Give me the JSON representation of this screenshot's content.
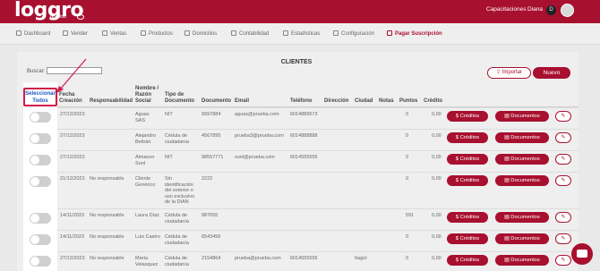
{
  "app": {
    "logo": "loggro",
    "logo_sub": "restobar",
    "org": "Capacitaciones",
    "user": "Diana",
    "user_badge": "D"
  },
  "nav": [
    {
      "label": "Dashboard",
      "icon": "dashboard-icon"
    },
    {
      "label": "Vender",
      "icon": "cart-icon"
    },
    {
      "label": "Ventas",
      "icon": "tag-icon"
    },
    {
      "label": "Productos",
      "icon": "box-icon"
    },
    {
      "label": "Domicilios",
      "icon": "delivery-icon"
    },
    {
      "label": "Contabilidad",
      "icon": "ledger-icon"
    },
    {
      "label": "Estadísticas",
      "icon": "chart-icon"
    },
    {
      "label": "Configuración",
      "icon": "gear-icon"
    },
    {
      "label": "Pagar Suscripción",
      "icon": "card-icon"
    }
  ],
  "page": {
    "title": "CLIENTES",
    "search_label": "Buscar:",
    "search_value": "",
    "import_label": "Importar",
    "new_label": "Nuevo",
    "select_all": "Seleccionar Todos"
  },
  "table": {
    "headers": {
      "fecha": "Fecha Creación",
      "responsabilidad": "Responsabilidad",
      "nombre": "Nombre / Razón Social",
      "tipo": "Tipo de Documento",
      "documento": "Documento",
      "email": "Email",
      "telefono": "Teléfono",
      "direccion": "Dirección",
      "ciudad": "Ciudad",
      "notas": "Notas",
      "puntos": "Puntos",
      "credito": "Crédito"
    },
    "credits_label": "$ Créditos",
    "docs_label": "Documentos",
    "rows": [
      {
        "fecha": "27/12/2023",
        "responsabilidad": "",
        "nombre": "Aguas SAS",
        "tipo": "NIT",
        "documento": "9997884",
        "email": "aguas@prueba.com",
        "telefono": "6014889573",
        "direccion": "",
        "ciudad": "",
        "puntos": "0",
        "credito": "0,00"
      },
      {
        "fecha": "27/12/2023",
        "responsabilidad": "",
        "nombre": "Alejandro Beltrán",
        "tipo": "Cédula de ciudadanía",
        "documento": "4567895",
        "email": "prueba3@prueba.com",
        "telefono": "6014888888",
        "direccion": "",
        "ciudad": "",
        "puntos": "0",
        "credito": "0,00"
      },
      {
        "fecha": "27/12/2023",
        "responsabilidad": "",
        "nombre": "Almacen Sunl",
        "tipo": "NIT",
        "documento": "98557771",
        "email": "sunl@prueba.com",
        "telefono": "6014555555",
        "direccion": "",
        "ciudad": "",
        "puntos": "0",
        "credito": "0,00"
      },
      {
        "fecha": "21/12/2023",
        "responsabilidad": "No responsable",
        "nombre": "Cliente Genérico",
        "tipo": "Sin identificación del exterior o uso exclusivo de la DIAN",
        "documento": "2222",
        "email": "",
        "telefono": "",
        "direccion": "",
        "ciudad": "",
        "puntos": "0",
        "credito": "0,00"
      },
      {
        "fecha": "14/11/2023",
        "responsabilidad": "No responsable",
        "nombre": "Laura Díaz",
        "tipo": "Cédula de ciudadanía",
        "documento": "987655",
        "email": "",
        "telefono": "",
        "direccion": "",
        "ciudad": "",
        "puntos": "591",
        "credito": "0,00"
      },
      {
        "fecha": "14/11/2023",
        "responsabilidad": "No responsable",
        "nombre": "Luis Castro",
        "tipo": "Cédula de ciudadanía",
        "documento": "6543456",
        "email": "",
        "telefono": "",
        "direccion": "",
        "ciudad": "",
        "puntos": "0",
        "credito": "0,00"
      },
      {
        "fecha": "27/12/2023",
        "responsabilidad": "No responsable",
        "nombre": "María Velasquez",
        "tipo": "Cédula de ciudadanía",
        "documento": "2154864",
        "email": "prueba@prueba.com",
        "telefono": "6014555555",
        "direccion": "",
        "ciudad": "Itagüí",
        "puntos": "0",
        "credito": "0,00"
      }
    ]
  },
  "colors": {
    "brand": "#a8102f",
    "annotation": "#d11a4a"
  }
}
